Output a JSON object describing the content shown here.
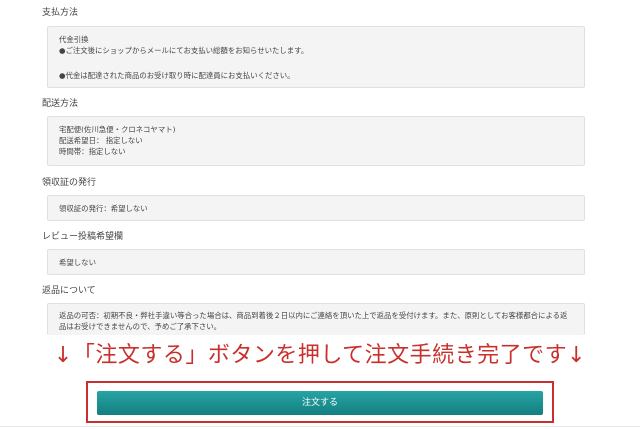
{
  "payment": {
    "heading": "支払方法",
    "lines": [
      "代金引換",
      "●ご注文後にショップからメールにてお支払い総額をお知らせいたします。",
      "●代金は配達された商品のお受け取り時に配達員にお支払いください。"
    ]
  },
  "shipping": {
    "heading": "配送方法",
    "lines": [
      "宅配便(佐川急便・クロネコヤマト)",
      "配送希望日： 指定しない",
      "時間帯：指定しない"
    ]
  },
  "receipt": {
    "heading": "領収証の発行",
    "value": "領収証の発行：希望しない"
  },
  "review": {
    "heading": "レビュー投稿希望欄",
    "value": "希望しない"
  },
  "returns": {
    "heading": "返品について",
    "text": "返品の可否：初期不良・弊社手違い等合った場合は、商品到着後２日以内にご連絡を頂いた上で返品を受付けます。また、原則としてお客様都合による返品はお受けできませんので、予めご了承下さい。"
  },
  "notice": {
    "text": "↓「注文する」ボタンを押して注文手続き完了です↓"
  },
  "order_button": {
    "label": "注文する"
  },
  "colors": {
    "notice_red": "#c9302c",
    "button_teal": "#1a9090",
    "box_bg": "#f4f4f4"
  }
}
